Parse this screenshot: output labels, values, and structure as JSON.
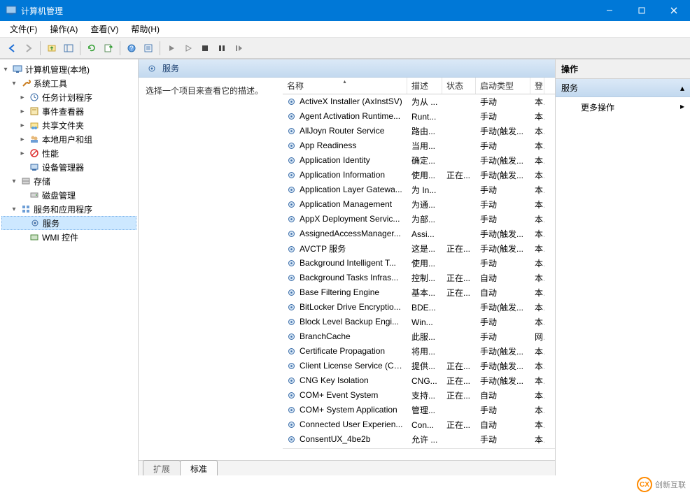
{
  "window": {
    "title": "计算机管理"
  },
  "menubar": [
    "文件(F)",
    "操作(A)",
    "查看(V)",
    "帮助(H)"
  ],
  "tree": {
    "root": "计算机管理(本地)",
    "system_tools": "系统工具",
    "task_scheduler": "任务计划程序",
    "event_viewer": "事件查看器",
    "shared_folders": "共享文件夹",
    "local_users": "本地用户和组",
    "performance": "性能",
    "device_manager": "设备管理器",
    "storage": "存储",
    "disk_mgmt": "磁盘管理",
    "services_apps": "服务和应用程序",
    "services": "服务",
    "wmi": "WMI 控件"
  },
  "center": {
    "header": "服务",
    "desc": "选择一个项目来查看它的描述。",
    "columns": {
      "name": "名称",
      "desc": "描述",
      "status": "状态",
      "startup": "启动类型",
      "logon": "登"
    },
    "tabs": {
      "extended": "扩展",
      "standard": "标准"
    }
  },
  "actions": {
    "header": "操作",
    "section": "服务",
    "more": "更多操作"
  },
  "services": [
    {
      "name": "ActiveX Installer (AxInstSV)",
      "desc": "为从 ...",
      "status": "",
      "startup": "手动",
      "logon": "本"
    },
    {
      "name": "Agent Activation Runtime...",
      "desc": "Runt...",
      "status": "",
      "startup": "手动",
      "logon": "本"
    },
    {
      "name": "AllJoyn Router Service",
      "desc": "路由...",
      "status": "",
      "startup": "手动(触发...",
      "logon": "本"
    },
    {
      "name": "App Readiness",
      "desc": "当用...",
      "status": "",
      "startup": "手动",
      "logon": "本"
    },
    {
      "name": "Application Identity",
      "desc": "确定...",
      "status": "",
      "startup": "手动(触发...",
      "logon": "本"
    },
    {
      "name": "Application Information",
      "desc": "使用...",
      "status": "正在...",
      "startup": "手动(触发...",
      "logon": "本"
    },
    {
      "name": "Application Layer Gatewa...",
      "desc": "为 In...",
      "status": "",
      "startup": "手动",
      "logon": "本"
    },
    {
      "name": "Application Management",
      "desc": "为通...",
      "status": "",
      "startup": "手动",
      "logon": "本"
    },
    {
      "name": "AppX Deployment Servic...",
      "desc": "为部...",
      "status": "",
      "startup": "手动",
      "logon": "本"
    },
    {
      "name": "AssignedAccessManager...",
      "desc": "Assi...",
      "status": "",
      "startup": "手动(触发...",
      "logon": "本"
    },
    {
      "name": "AVCTP 服务",
      "desc": "这是...",
      "status": "正在...",
      "startup": "手动(触发...",
      "logon": "本"
    },
    {
      "name": "Background Intelligent T...",
      "desc": "使用...",
      "status": "",
      "startup": "手动",
      "logon": "本"
    },
    {
      "name": "Background Tasks Infras...",
      "desc": "控制...",
      "status": "正在...",
      "startup": "自动",
      "logon": "本"
    },
    {
      "name": "Base Filtering Engine",
      "desc": "基本...",
      "status": "正在...",
      "startup": "自动",
      "logon": "本"
    },
    {
      "name": "BitLocker Drive Encryptio...",
      "desc": "BDE...",
      "status": "",
      "startup": "手动(触发...",
      "logon": "本"
    },
    {
      "name": "Block Level Backup Engi...",
      "desc": "Win...",
      "status": "",
      "startup": "手动",
      "logon": "本"
    },
    {
      "name": "BranchCache",
      "desc": "此服...",
      "status": "",
      "startup": "手动",
      "logon": "网"
    },
    {
      "name": "Certificate Propagation",
      "desc": "将用...",
      "status": "",
      "startup": "手动(触发...",
      "logon": "本"
    },
    {
      "name": "Client License Service (Cli...",
      "desc": "提供...",
      "status": "正在...",
      "startup": "手动(触发...",
      "logon": "本"
    },
    {
      "name": "CNG Key Isolation",
      "desc": "CNG...",
      "status": "正在...",
      "startup": "手动(触发...",
      "logon": "本"
    },
    {
      "name": "COM+ Event System",
      "desc": "支持...",
      "status": "正在...",
      "startup": "自动",
      "logon": "本"
    },
    {
      "name": "COM+ System Application",
      "desc": "管理...",
      "status": "",
      "startup": "手动",
      "logon": "本"
    },
    {
      "name": "Connected User Experien...",
      "desc": "Con...",
      "status": "正在...",
      "startup": "自动",
      "logon": "本"
    },
    {
      "name": "ConsentUX_4be2b",
      "desc": "允许 ...",
      "status": "",
      "startup": "手动",
      "logon": "本"
    }
  ],
  "footer": {
    "brand": "创新互联"
  }
}
